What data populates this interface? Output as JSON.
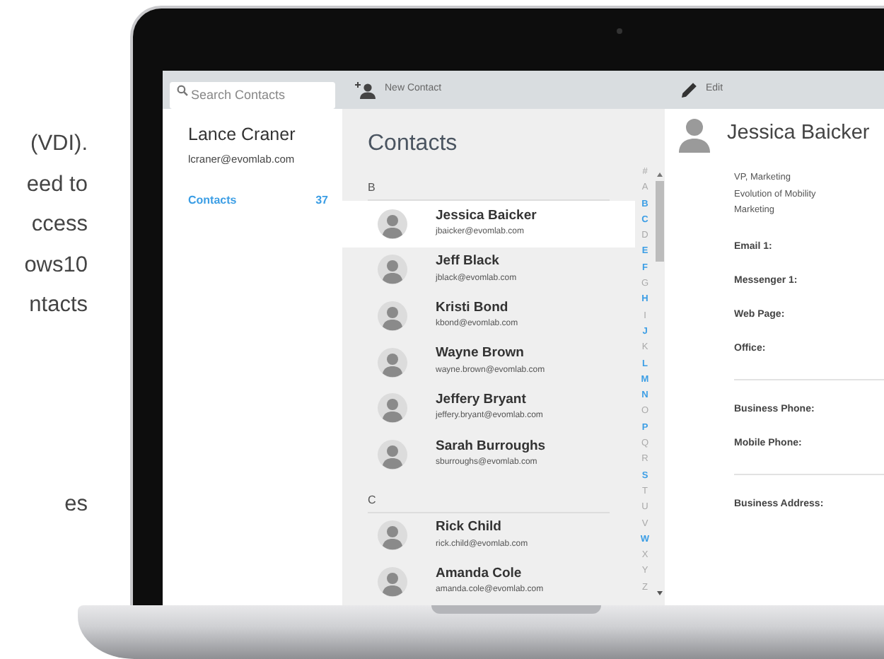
{
  "page_text": [
    [
      "(VDI).",
      "eed to",
      "ccess",
      "ows10",
      "ntacts"
    ],
    [
      "es"
    ]
  ],
  "search": {
    "placeholder": "Search Contacts"
  },
  "toolbar": {
    "new_contact": "New Contact",
    "edit": "Edit"
  },
  "account": {
    "name": "Lance Craner",
    "email": "lcraner@evomlab.com"
  },
  "folders": [
    {
      "label": "Contacts",
      "count": "37",
      "selected": true
    }
  ],
  "list": {
    "title": "Contacts",
    "groups": [
      {
        "letter": "B",
        "contacts": [
          {
            "name": "Jessica Baicker",
            "email": "jbaicker@evomlab.com",
            "selected": true
          },
          {
            "name": "Jeff Black",
            "email": "jblack@evomlab.com",
            "selected": false
          },
          {
            "name": "Kristi Bond",
            "email": "kbond@evomlab.com",
            "selected": false
          },
          {
            "name": "Wayne Brown",
            "email": "wayne.brown@evomlab.com",
            "selected": false
          },
          {
            "name": "Jeffery Bryant",
            "email": "jeffery.bryant@evomlab.com",
            "selected": false
          },
          {
            "name": "Sarah Burroughs",
            "email": "sburroughs@evomlab.com",
            "selected": false
          }
        ]
      },
      {
        "letter": "C",
        "contacts": [
          {
            "name": "Rick Child",
            "email": "rick.child@evomlab.com",
            "selected": false
          },
          {
            "name": "Amanda Cole",
            "email": "amanda.cole@evomlab.com",
            "selected": false
          }
        ]
      }
    ]
  },
  "alphabet": [
    {
      "letter": "#",
      "enabled": false
    },
    {
      "letter": "A",
      "enabled": false
    },
    {
      "letter": "B",
      "enabled": true
    },
    {
      "letter": "C",
      "enabled": true
    },
    {
      "letter": "D",
      "enabled": false
    },
    {
      "letter": "E",
      "enabled": true
    },
    {
      "letter": "F",
      "enabled": true
    },
    {
      "letter": "G",
      "enabled": false
    },
    {
      "letter": "H",
      "enabled": true
    },
    {
      "letter": "I",
      "enabled": false
    },
    {
      "letter": "J",
      "enabled": true
    },
    {
      "letter": "K",
      "enabled": false
    },
    {
      "letter": "L",
      "enabled": true
    },
    {
      "letter": "M",
      "enabled": true
    },
    {
      "letter": "N",
      "enabled": true
    },
    {
      "letter": "O",
      "enabled": false
    },
    {
      "letter": "P",
      "enabled": true
    },
    {
      "letter": "Q",
      "enabled": false
    },
    {
      "letter": "R",
      "enabled": false
    },
    {
      "letter": "S",
      "enabled": true
    },
    {
      "letter": "T",
      "enabled": false
    },
    {
      "letter": "U",
      "enabled": false
    },
    {
      "letter": "V",
      "enabled": false
    },
    {
      "letter": "W",
      "enabled": true
    },
    {
      "letter": "X",
      "enabled": false
    },
    {
      "letter": "Y",
      "enabled": false
    },
    {
      "letter": "Z",
      "enabled": false
    }
  ],
  "details": {
    "name": "Jessica Baicker",
    "lines": [
      "VP, Marketing",
      "Evolution of Mobility",
      "Marketing"
    ],
    "sections": [
      {
        "fields": [
          "Email 1:",
          "Messenger 1:",
          "Web Page:",
          "Office:"
        ]
      },
      {
        "fields": [
          "Business Phone:",
          "Mobile Phone:"
        ]
      },
      {
        "fields": [
          "Business Address:"
        ]
      }
    ]
  }
}
